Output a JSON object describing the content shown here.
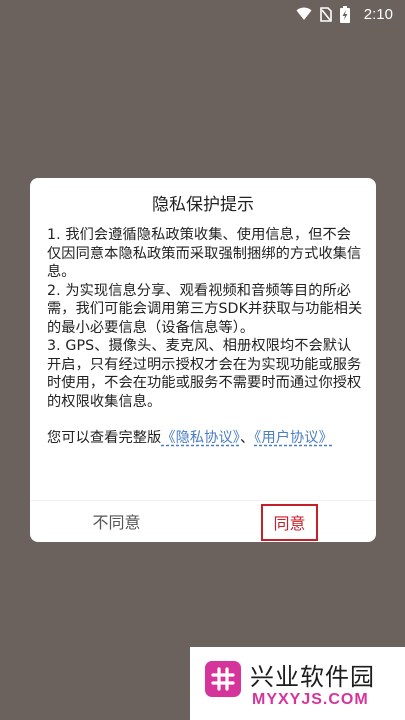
{
  "status_bar": {
    "time": "2:10",
    "icons": [
      "wifi-icon",
      "no-sim-icon",
      "battery-charging-icon"
    ]
  },
  "dialog": {
    "title": "隐私保护提示",
    "items": [
      "1. 我们会遵循隐私政策收集、使用信息，但不会仅因同意本隐私政策而采取强制捆绑的方式收集信息。",
      "2. 为实现信息分享、观看视频和音频等目的所必需，我们可能会调用第三方SDK并获取与功能相关的最小必要信息（设备信息等）。",
      "3. GPS、摄像头、麦克风、相册权限均不会默认开启，只有经过明示授权才会在为实现功能或服务时使用，不会在功能或服务不需要时而通过你授权的权限收集信息。"
    ],
    "agreement_prefix": "您可以查看完整版",
    "privacy_link": "《隐私协议》",
    "separator": "、",
    "user_link": "《用户协议》",
    "disagree_label": "不同意",
    "agree_label": "同意"
  },
  "watermark": {
    "title": "兴业软件园",
    "subtitle": "MYXYJS.COM",
    "brand_color": "#d5359b"
  }
}
